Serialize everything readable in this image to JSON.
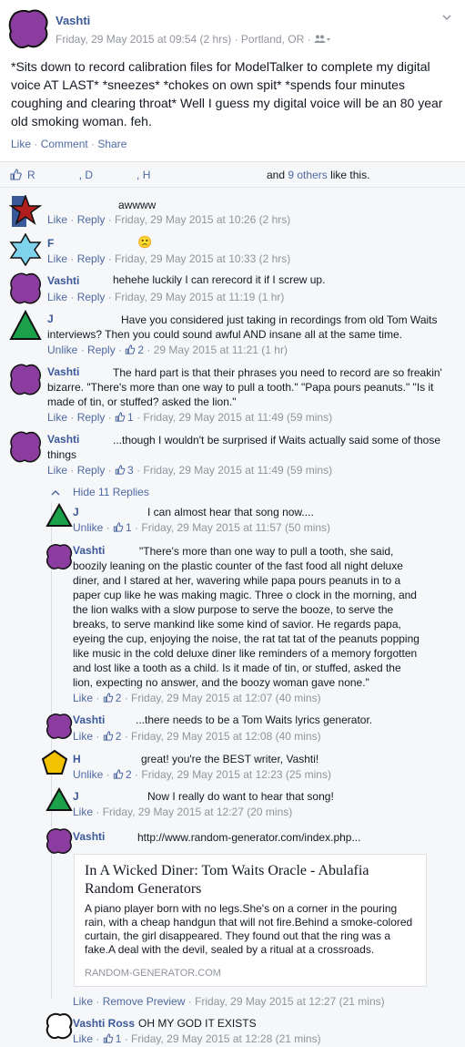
{
  "post": {
    "author": "Vashti",
    "date": "Friday, 29 May 2015 at 09:54 (2 hrs)",
    "location": "Portland, OR",
    "audience_icon": "friends-icon",
    "text": "*Sits down to record calibration files for ModelTalker to complete my digital voice AT LAST* *sneezes* *chokes on own spit* *spends four minutes coughing and clearing throat* Well I guess my digital voice will be an 80 year old smoking woman. feh.",
    "actions": [
      "Like",
      "Comment",
      "Share"
    ]
  },
  "likes": {
    "names": [
      "R",
      "D",
      "H"
    ],
    "and_text": "and",
    "others": "9 others",
    "suffix": "like this."
  },
  "comments": [
    {
      "author": "",
      "text": "awwww",
      "actions": [
        "Like",
        "Reply"
      ],
      "date": "Friday, 29 May 2015 at 10:26 (2 hrs)"
    },
    {
      "author": "F",
      "text": "🙁",
      "actions": [
        "Like",
        "Reply"
      ],
      "date": "Friday, 29 May 2015 at 10:33 (2 hrs)"
    },
    {
      "author": "Vashti",
      "text": "hehehe luckily I can rerecord it if I screw up.",
      "actions": [
        "Like",
        "Reply"
      ],
      "date": "Friday, 29 May 2015 at 11:19 (1 hr)"
    },
    {
      "author": "J",
      "text": "Have you considered just taking in recordings from old Tom Waits interviews? Then you could sound awful AND insane all at the same time.",
      "actions": [
        "Unlike",
        "Reply"
      ],
      "likes": "2",
      "date": "29 May 2015 at 11:21 (1 hr)"
    },
    {
      "author": "Vashti",
      "text": "The hard part is that their phrases you need to record are so freakin' bizarre. \"There's more than one way to pull a tooth.\" \"Papa pours peanuts.\" \"Is it made of tin, or stuffed? asked the lion.\"",
      "actions": [
        "Like",
        "Reply"
      ],
      "likes": "1",
      "date": "Friday, 29 May 2015 at 11:49 (59 mins)"
    },
    {
      "author": "Vashti",
      "text": "...though I wouldn't be surprised if Waits actually said some of those things",
      "actions": [
        "Like",
        "Reply"
      ],
      "likes": "3",
      "date": "Friday, 29 May 2015 at 11:49 (59 mins)"
    }
  ],
  "hide_replies": "Hide 11 Replies",
  "replies": [
    {
      "author": "J",
      "text": "I can almost hear that song now....",
      "actions": [
        "Unlike"
      ],
      "likes": "1",
      "date": "Friday, 29 May 2015 at 11:57 (50 mins)"
    },
    {
      "author": "Vashti",
      "text": "\"There's more than one way to pull a tooth, she said, boozily leaning on the plastic counter of the fast food all night deluxe diner, and I stared at her, wavering while papa pours peanuts in to a paper cup like he was making magic. Three o clock in the morning, and the lion walks with a slow purpose to serve the booze, to serve the breaks, to serve mankind like some kind of savior. He regards papa, eyeing the cup, enjoying the noise, the rat tat tat of the peanuts popping like music in the cold deluxe diner like reminders of a memory forgotten and lost like a tooth as a child. Is it made of tin, or stuffed, asked the lion, expecting no answer, and the boozy woman gave none.\"",
      "actions": [
        "Like"
      ],
      "likes": "2",
      "date": "Friday, 29 May 2015 at 12:07 (40 mins)"
    },
    {
      "author": "Vashti",
      "text": "...there needs to be a Tom Waits lyrics generator.",
      "actions": [
        "Like"
      ],
      "likes": "2",
      "date": "Friday, 29 May 2015 at 12:08 (40 mins)"
    },
    {
      "author": "H",
      "text": "great! you're the BEST writer, Vashti!",
      "actions": [
        "Unlike"
      ],
      "likes": "2",
      "date": "Friday, 29 May 2015 at 12:23 (25 mins)"
    },
    {
      "author": "J",
      "text": "Now I really do want to hear that song!",
      "actions": [
        "Like"
      ],
      "date": "Friday, 29 May 2015 at 12:27 (20 mins)"
    },
    {
      "author": "Vashti",
      "text": "http://www.random-generator.com/index.php...",
      "actions": [
        "Like",
        "Remove Preview"
      ],
      "date": "Friday, 29 May 2015 at 12:27 (21 mins)"
    },
    {
      "author": "Vashti Ross",
      "text": "OH MY GOD IT EXISTS",
      "actions": [
        "Like"
      ],
      "likes": "1",
      "date": "Friday, 29 May 2015 at 12:28 (21 mins)"
    }
  ],
  "link_preview": {
    "title": "In A Wicked Diner: Tom Waits Oracle - Abulafia Random Generators",
    "description": "A piano player born with no legs.She's on a corner in the pouring rain, with a cheap handgun that will not fire.Behind a smoke-colored curtain, the girl disappeared. They found out that the ring was a fake.A deal with the devil, sealed by a ritual at a crossroads.",
    "domain": "RANDOM-GENERATOR.COM"
  },
  "colors": {
    "link": "#4e69a2",
    "name": "#3b5998",
    "meta": "#90949c",
    "purple": "#8a3d9e",
    "green": "#1aa14a",
    "yellow": "#f2c200",
    "cyan": "#7fd3ec",
    "red": "#b01e1e"
  }
}
